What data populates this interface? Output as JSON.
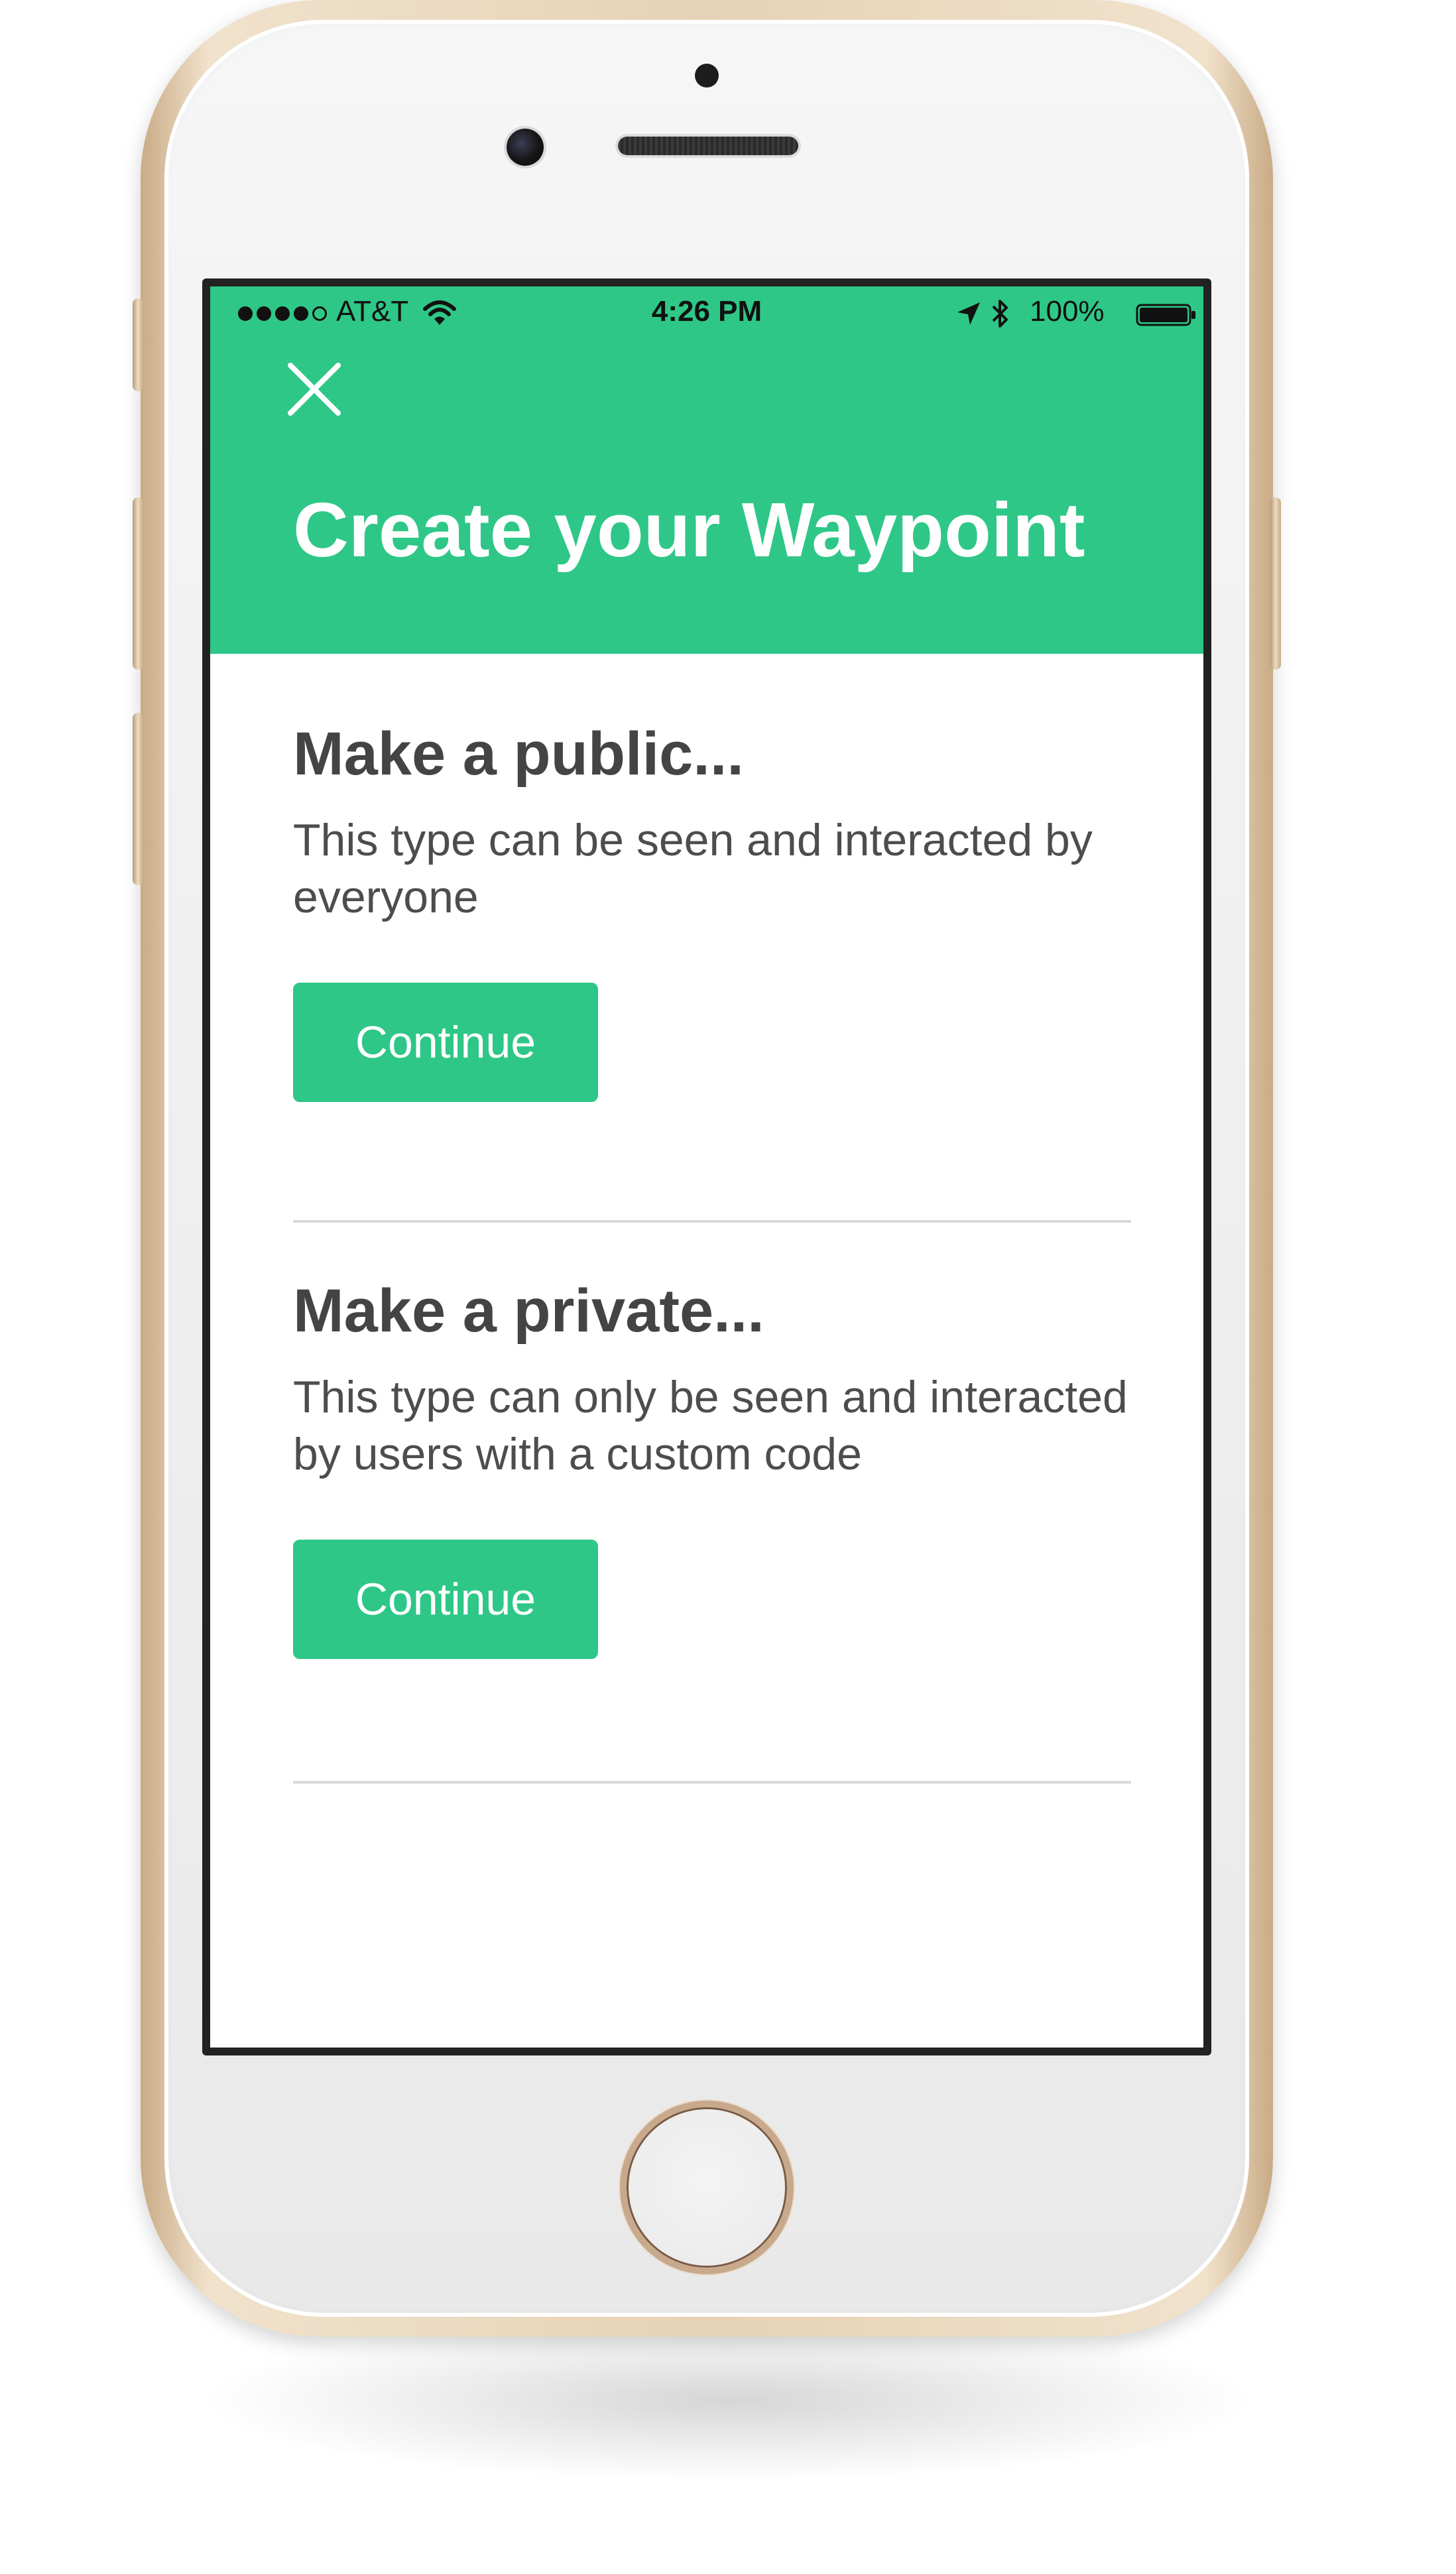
{
  "status_bar": {
    "carrier": "AT&T",
    "time": "4:26 PM",
    "battery": "100%",
    "signal_bars_filled": 4,
    "signal_bars_total": 5,
    "icons": [
      "wifi-icon",
      "location-arrow-icon",
      "bluetooth-icon",
      "battery-icon"
    ]
  },
  "header": {
    "close_icon": "close-icon",
    "title": "Create your Waypoint"
  },
  "options": [
    {
      "title": "Make a public...",
      "description": "This type can be seen and interacted by everyone",
      "button_label": "Continue"
    },
    {
      "title": "Make a private...",
      "description": "This type can only be seen and interacted by users with a custom code",
      "button_label": "Continue"
    }
  ],
  "colors": {
    "accent": "#2ec787",
    "heading_text": "#444444",
    "body_text": "#4d4d4d",
    "divider": "#d9d9d9"
  }
}
